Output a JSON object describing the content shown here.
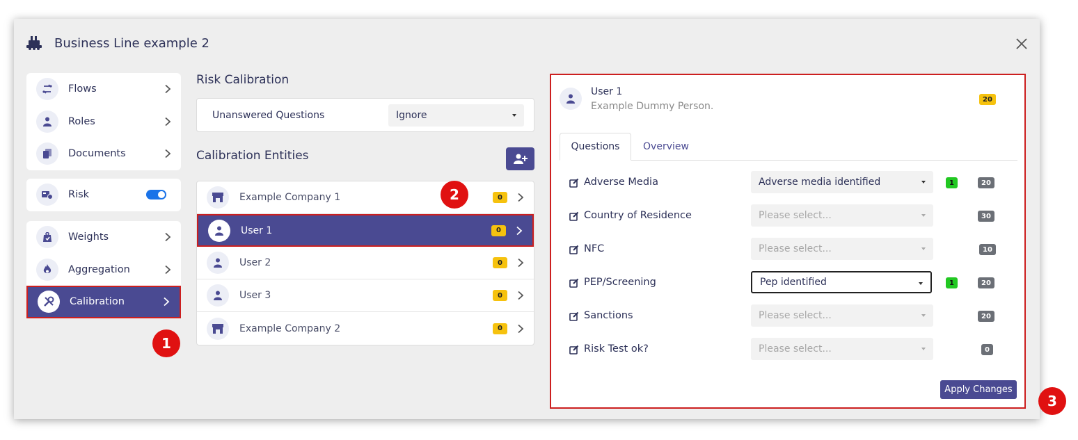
{
  "dialog": {
    "title": "Business Line example 2",
    "title_icon": "business-line-icon",
    "close_icon": "close-icon"
  },
  "nav": {
    "group1": [
      {
        "label": "Flows",
        "icon": "flows-icon"
      },
      {
        "label": "Roles",
        "icon": "roles-icon"
      },
      {
        "label": "Documents",
        "icon": "documents-icon"
      }
    ],
    "risk": {
      "label": "Risk",
      "icon": "risk-icon",
      "toggle_on": true
    },
    "group2": [
      {
        "label": "Weights",
        "icon": "weights-icon"
      },
      {
        "label": "Aggregation",
        "icon": "aggregation-icon"
      },
      {
        "label": "Calibration",
        "icon": "calibration-icon",
        "active": true
      }
    ]
  },
  "markers": [
    "1",
    "2",
    "3"
  ],
  "risk_calibration": {
    "title": "Risk Calibration",
    "unanswered_label": "Unanswered Questions",
    "unanswered_value": "Ignore"
  },
  "entities": {
    "title": "Calibration Entities",
    "add_icon": "add-user-icon",
    "items": [
      {
        "name": "Example Company 1",
        "icon": "company-icon",
        "badge": "0"
      },
      {
        "name": "User 1",
        "icon": "user-icon",
        "badge": "0",
        "active": true
      },
      {
        "name": "User 2",
        "icon": "user-icon",
        "badge": "0"
      },
      {
        "name": "User 3",
        "icon": "user-icon",
        "badge": "0"
      },
      {
        "name": "Example Company 2",
        "icon": "company-icon",
        "badge": "0"
      }
    ]
  },
  "detail": {
    "name": "User 1",
    "subtitle": "Example Dummy Person.",
    "score": "20",
    "tabs": [
      "Questions",
      "Overview"
    ],
    "questions": [
      {
        "label": "Adverse Media",
        "value": "Adverse media identified",
        "placeholder": false,
        "count": "1",
        "points": "20"
      },
      {
        "label": "Country of Residence",
        "value": "Please select...",
        "placeholder": true,
        "count": "",
        "points": "30"
      },
      {
        "label": "NFC",
        "value": "Please select...",
        "placeholder": true,
        "count": "",
        "points": "10"
      },
      {
        "label": "PEP/Screening",
        "value": "Pep identified",
        "placeholder": false,
        "focused": true,
        "count": "1",
        "points": "20"
      },
      {
        "label": "Sanctions",
        "value": "Please select...",
        "placeholder": true,
        "count": "",
        "points": "20"
      },
      {
        "label": "Risk Test ok?",
        "value": "Please select...",
        "placeholder": true,
        "count": "",
        "points": "0"
      }
    ],
    "apply_label": "Apply Changes"
  },
  "colors": {
    "accent": "#4a4a92",
    "highlight_border": "#cc1f1f",
    "marker": "#e01111",
    "badge_yellow": "#f6c20e",
    "badge_green": "#22c822",
    "badge_gray": "#6b6f76",
    "toggle": "#1a73e8"
  }
}
